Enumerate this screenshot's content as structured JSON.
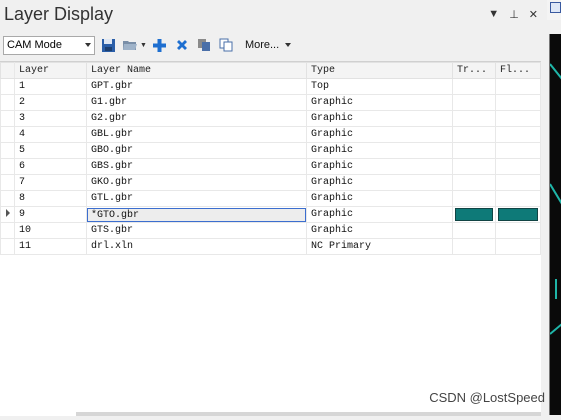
{
  "panel": {
    "title": "Layer Display"
  },
  "toolbar": {
    "mode": "CAM Mode",
    "more": "More..."
  },
  "grid": {
    "columns": [
      "Layer",
      "Layer Name",
      "Type",
      "Tr...",
      "Fl..."
    ],
    "rows": [
      {
        "layer": "1",
        "name": "GPT.gbr",
        "type": "Top"
      },
      {
        "layer": "2",
        "name": "G1.gbr",
        "type": "Graphic"
      },
      {
        "layer": "3",
        "name": "G2.gbr",
        "type": "Graphic"
      },
      {
        "layer": "4",
        "name": "GBL.gbr",
        "type": "Graphic"
      },
      {
        "layer": "5",
        "name": "GBO.gbr",
        "type": "Graphic"
      },
      {
        "layer": "6",
        "name": "GBS.gbr",
        "type": "Graphic"
      },
      {
        "layer": "7",
        "name": "GKO.gbr",
        "type": "Graphic"
      },
      {
        "layer": "8",
        "name": "GTL.gbr",
        "type": "Graphic"
      },
      {
        "layer": "9",
        "name": "*GTO.gbr",
        "type": "Graphic",
        "selected": true
      },
      {
        "layer": "10",
        "name": "GTS.gbr",
        "type": "Graphic"
      },
      {
        "layer": "11",
        "name": "drl.xln",
        "type": "NC Primary"
      }
    ]
  },
  "colors": {
    "swatch": "#0e7a78",
    "selection_border": "#3c6ecf"
  },
  "watermark": "CSDN @LostSpeed"
}
